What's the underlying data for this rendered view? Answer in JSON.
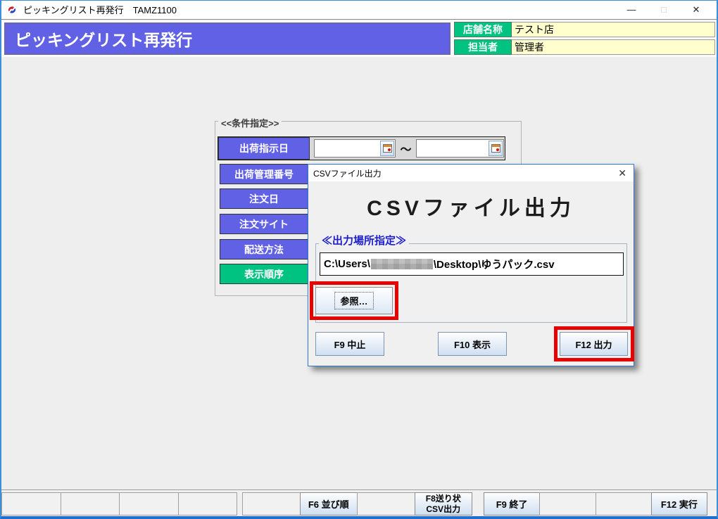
{
  "colors": {
    "header_blue": "#6161e6",
    "label_green": "#00c381",
    "field_yellow": "#ffffcd",
    "highlight_red": "#e60000",
    "dialog_border_blue": "#2e79d0"
  },
  "window": {
    "title": "ピッキングリスト再発行　TAMZ1100",
    "minimize_glyph": "—",
    "maximize_glyph": "□",
    "close_glyph": "✕"
  },
  "header": {
    "title": "ピッキングリスト再発行",
    "store_label": "店舗名称",
    "store_value": "テスト店",
    "staff_label": "担当者",
    "staff_value": "管理者"
  },
  "condition": {
    "legend": "<<条件指定>>",
    "range_separator": "～",
    "rows": [
      {
        "label": "出荷指示日"
      },
      {
        "label": "出荷管理番号"
      },
      {
        "label": "注文日"
      },
      {
        "label": "注文サイト"
      },
      {
        "label": "配送方法"
      },
      {
        "label": "表示順序"
      }
    ]
  },
  "dialog": {
    "titlebar": "CSVファイル出力",
    "close_glyph": "✕",
    "heading": "CSVファイル出力",
    "location_legend": "≪出力場所指定≫",
    "path_prefix": "C:\\Users\\",
    "path_suffix": "\\Desktop\\ゆうパック.csv",
    "browse_label": "参照…",
    "cancel_label": "F9 中止",
    "show_label": "F10 表示",
    "output_label": "F12 出力"
  },
  "function_bar": {
    "slots": [
      "",
      "",
      "",
      "",
      "",
      "F6 並び順",
      "",
      "F8送り状\nCSV出力",
      "F9 終了",
      "",
      "",
      "F12 実行"
    ]
  }
}
